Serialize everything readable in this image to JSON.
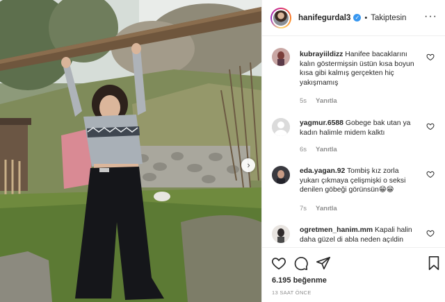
{
  "post": {
    "username": "hanifegurdal3",
    "follow_state": "Takiptesin",
    "likes_text": "6.195 beğenme",
    "timestamp": "13 SAAT ÖNCE"
  },
  "comments": [
    {
      "username": "kubrayiildizz",
      "text": "Hanifee bacaklarını kalın göstermişsin üstün kısa boyun kısa gibi kalmış gerçekten hiç yakışmamış",
      "age": "5s",
      "reply_label": "Yanıtla"
    },
    {
      "username": "yagmur.6588",
      "text": "Gobege bak utan ya kadın halimle midem kalktı",
      "age": "6s",
      "reply_label": "Yanıtla"
    },
    {
      "username": "eda.yagan.92",
      "text": "Tombiş kız zorla yukarı çıkmaya çelişmişki o seksi denilen göbeği görünsün😁😁",
      "age": "7s",
      "reply_label": "Yanıtla"
    },
    {
      "username": "ogretmen_hanim.mm",
      "text": "Kapali halin daha güzel di abla neden açıldin",
      "age": "",
      "reply_label": ""
    }
  ],
  "icons": {
    "like": "heart-icon",
    "comment": "comment-icon",
    "share": "paper-plane-icon",
    "save": "bookmark-icon",
    "more": "more-options-icon",
    "carousel_next": "chevron-right-icon"
  },
  "colors": {
    "verified": "#3897f0",
    "muted_text": "#8e8e8e",
    "primary_text": "#262626"
  }
}
